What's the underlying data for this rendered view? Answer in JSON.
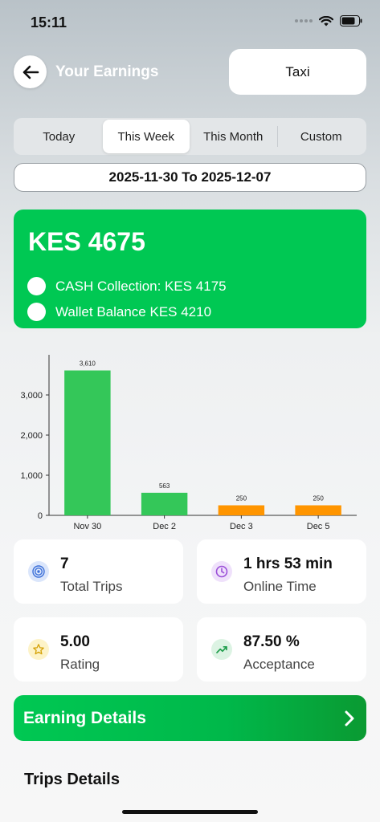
{
  "status_bar": {
    "time": "15:11"
  },
  "header": {
    "title": "Your Earnings",
    "service": "Taxi"
  },
  "tabs": [
    {
      "label": "Today",
      "active": false
    },
    {
      "label": "This Week",
      "active": true
    },
    {
      "label": "This Month",
      "active": false
    },
    {
      "label": "Custom",
      "active": false
    }
  ],
  "date_range": "2025-11-30 To 2025-12-07",
  "summary": {
    "total": "KES 4675",
    "cash_collection": "CASH Collection: KES 4175",
    "wallet_balance": "Wallet Balance KES 4210",
    "color": "#00c853"
  },
  "chart_data": {
    "type": "bar",
    "categories": [
      "Nov 30",
      "Dec 2",
      "Dec 3",
      "Dec 5"
    ],
    "values": [
      3610,
      563,
      250,
      250
    ],
    "value_labels": [
      "3,610",
      "563",
      "250",
      "250"
    ],
    "colors": [
      "#34c759",
      "#34c759",
      "#ff9500",
      "#ff9500"
    ],
    "yticks": [
      "0",
      "1,000",
      "2,000",
      "3,000"
    ],
    "ylim": [
      0,
      4000
    ],
    "grid": false,
    "legend": "none"
  },
  "stats": [
    {
      "value": "7",
      "label": "Total Trips",
      "icon": "target-icon",
      "icon_bg": "#dbe6fb",
      "icon_color": "#3b6fd8"
    },
    {
      "value": "1 hrs 53 min",
      "label": "Online Time",
      "icon": "clock-icon",
      "icon_bg": "#efe1fb",
      "icon_color": "#9b4fd8"
    },
    {
      "value": "5.00",
      "label": "Rating",
      "icon": "star-icon",
      "icon_bg": "#fdf3c8",
      "icon_color": "#d4a106"
    },
    {
      "value": "87.50 %",
      "label": "Acceptance",
      "icon": "trend-up-icon",
      "icon_bg": "#dcf3e3",
      "icon_color": "#1f9d4c"
    }
  ],
  "earning_details": {
    "label": "Earning Details"
  },
  "trips_details": {
    "title": "Trips Details"
  }
}
